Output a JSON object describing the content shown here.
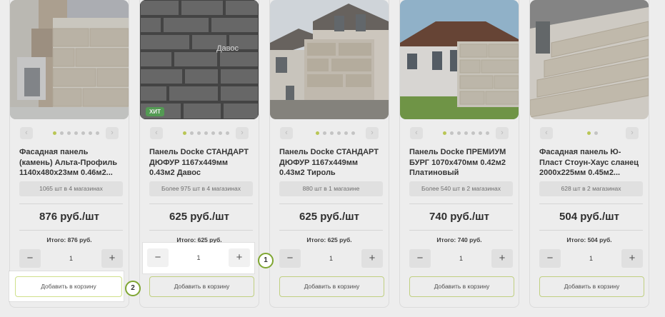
{
  "products": [
    {
      "title": "Фасадная панель (камень) Альта-Профиль 1140х480х23мм 0.46м2...",
      "stock": "1065 шт в 4 магазинах",
      "price": "876 руб./шт",
      "total": "Итого: 876 руб.",
      "quantity": "1",
      "cart_label": "Добавить в корзину",
      "badge": "",
      "photo_label": ""
    },
    {
      "title": "Панель Docke СТАНДАРТ ДЮФУР 1167х449мм 0.43м2 Давос",
      "stock": "Более 975 шт в 4 магазинах",
      "price": "625 руб./шт",
      "total": "Итого: 625 руб.",
      "quantity": "1",
      "cart_label": "Добавить в корзину",
      "badge": "ХИТ",
      "photo_label": "Давос"
    },
    {
      "title": "Панель Docke СТАНДАРТ ДЮФУР 1167х449мм 0.43м2 Тироль",
      "stock": "880 шт в 1 магазине",
      "price": "625 руб./шт",
      "total": "Итого: 625 руб.",
      "quantity": "1",
      "cart_label": "Добавить в корзину",
      "badge": "",
      "photo_label": ""
    },
    {
      "title": "Панель Docke ПРЕМИУМ БУРГ 1070х470мм 0.42м2 Платиновый",
      "stock": "Более 540 шт в 2 магазинах",
      "price": "740 руб./шт",
      "total": "Итого: 740 руб.",
      "quantity": "1",
      "cart_label": "Добавить в корзину",
      "badge": "",
      "photo_label": ""
    },
    {
      "title": "Фасадная панель Ю-Пласт Стоун-Хаус сланец 2000х225мм 0.45м2...",
      "stock": "628 шт в 2 магазинах",
      "price": "504 руб./шт",
      "total": "Итого: 504 руб.",
      "quantity": "1",
      "cart_label": "Добавить в корзину",
      "badge": "",
      "photo_label": ""
    }
  ],
  "controls": {
    "minus": "−",
    "plus": "+",
    "prev": "‹",
    "next": "›"
  },
  "highlight": {
    "stepper_quantity": "1",
    "cart_label": "Добавить в корзину",
    "marker_1": "1",
    "marker_2": "2"
  },
  "colors": {
    "accent": "#c7d65c",
    "cart_border": "#cfe08b",
    "badge": "#5aa65a",
    "marker_ring": "#7fa632"
  }
}
